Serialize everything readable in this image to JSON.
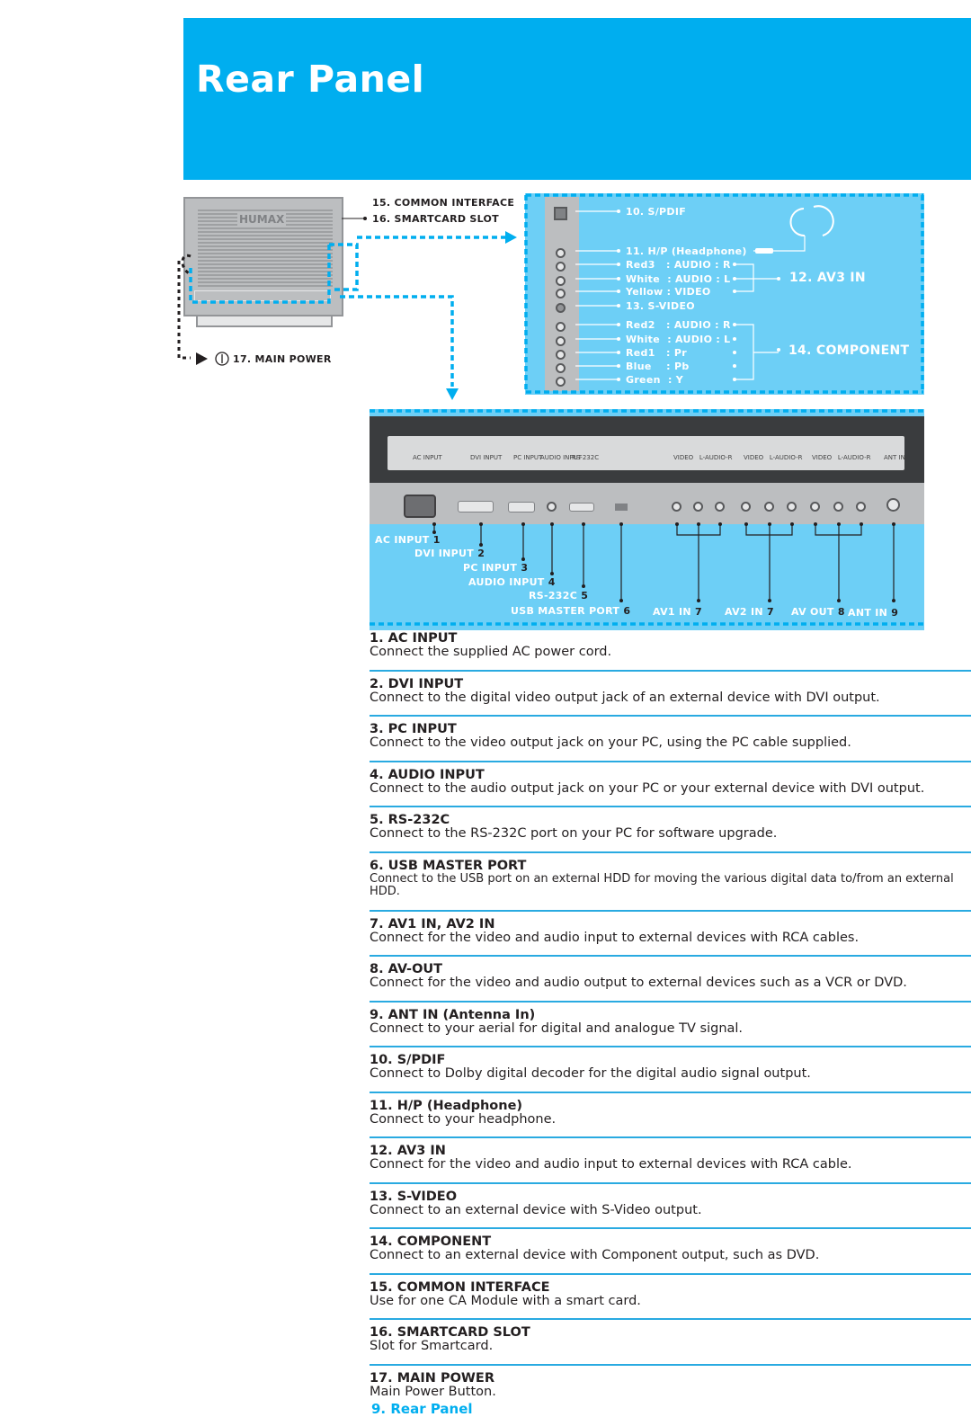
{
  "header": {
    "title": "Rear Panel"
  },
  "tv": {
    "brand": "HUMAX",
    "common_interface": "15. COMMON INTERFACE",
    "smartcard_slot": "16. SMARTCARD SLOT",
    "main_power": "17. MAIN POWER"
  },
  "side_panel": {
    "rows": [
      {
        "label": "10. S/PDIF"
      },
      {
        "label": "11. H/P (Headphone)"
      },
      {
        "label": "Red3   : AUDIO : R"
      },
      {
        "label": "White  : AUDIO : L"
      },
      {
        "label": "Yellow : VIDEO"
      },
      {
        "label": "13. S-VIDEO"
      },
      {
        "label": "Red2   : AUDIO : R"
      },
      {
        "label": "White  : AUDIO : L"
      },
      {
        "label": "Red1   : Pr"
      },
      {
        "label": "Blue    : Pb"
      },
      {
        "label": "Green  : Y"
      }
    ],
    "av3": "12. AV3 IN",
    "component": "14. COMPONENT"
  },
  "bottom_panel": {
    "photo_labels": [
      "AC INPUT",
      "DVI INPUT",
      "PC INPUT",
      "AUDIO INPUT",
      "RS-232C",
      "VIDEO   L-AUDIO-R",
      "VIDEO   L-AUDIO-R",
      "VIDEO   L-AUDIO-R",
      "ANT IN"
    ],
    "labels": [
      {
        "text": "AC INPUT",
        "num": "1"
      },
      {
        "text": "DVI INPUT",
        "num": "2"
      },
      {
        "text": "PC INPUT",
        "num": "3"
      },
      {
        "text": "AUDIO INPUT",
        "num": "4"
      },
      {
        "text": "RS-232C",
        "num": "5"
      },
      {
        "text": "USB MASTER PORT",
        "num": "6"
      },
      {
        "text": "AV1 IN",
        "num": "7"
      },
      {
        "text": "AV2 IN",
        "num": "7"
      },
      {
        "text": "AV OUT",
        "num": "8"
      },
      {
        "text": "ANT IN",
        "num": "9"
      }
    ]
  },
  "items": [
    {
      "title": "1. AC INPUT",
      "desc": "Connect the supplied AC power cord."
    },
    {
      "title": "2. DVI INPUT",
      "desc": "Connect to the digital video output jack of an external device with DVI output."
    },
    {
      "title": "3. PC INPUT",
      "desc": "Connect to the video output jack on your PC, using the PC cable supplied."
    },
    {
      "title": "4. AUDIO INPUT",
      "desc": "Connect to the audio output jack on your PC or your external device with DVI output."
    },
    {
      "title": "5. RS-232C",
      "desc": "Connect to the RS-232C port on your PC for software upgrade."
    },
    {
      "title": "6. USB MASTER PORT",
      "desc": "Connect to the USB port on an external HDD for moving the various digital data to/from an external HDD."
    },
    {
      "title": "7. AV1 IN, AV2 IN",
      "desc": "Connect for the video and audio input to external devices with RCA cables."
    },
    {
      "title": "8. AV-OUT",
      "desc": "Connect for the video and audio output to external devices such as a VCR or DVD."
    },
    {
      "title": "9. ANT IN (Antenna In)",
      "desc": "Connect to your aerial for digital and analogue TV signal."
    },
    {
      "title": "10. S/PDIF",
      "desc": "Connect to Dolby digital decoder for the digital audio signal output."
    },
    {
      "title": "11. H/P (Headphone)",
      "desc": "Connect to your headphone."
    },
    {
      "title": "12. AV3 IN",
      "desc": "Connect for the video and audio input to external devices with RCA cable."
    },
    {
      "title": "13. S-VIDEO",
      "desc": "Connect to an external device with S-Video output."
    },
    {
      "title": "14. COMPONENT",
      "desc": "Connect to an external device with Component output, such as DVD."
    },
    {
      "title": "15. COMMON INTERFACE",
      "desc": "Use for one CA Module with a smart card."
    },
    {
      "title": "16. SMARTCARD SLOT",
      "desc": "Slot for Smartcard."
    },
    {
      "title": "17. MAIN POWER",
      "desc": "Main Power Button."
    }
  ],
  "footer": "9. Rear Panel",
  "colors": {
    "accent": "#00aeef",
    "panel": "#6dcff6",
    "divider": "#29aae1"
  }
}
